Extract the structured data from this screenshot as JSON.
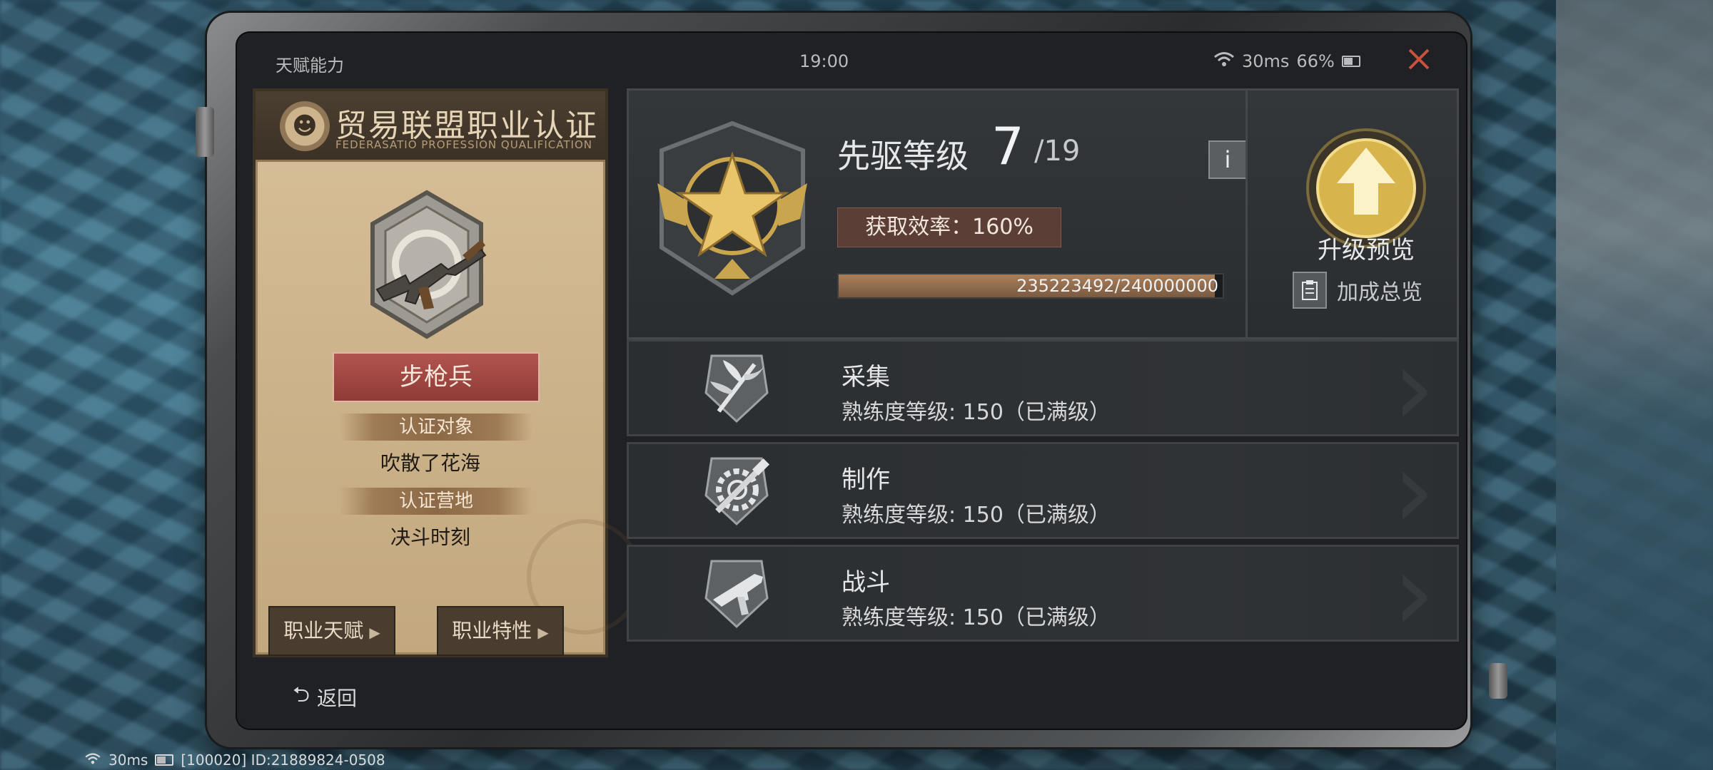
{
  "status_bar": {
    "title": "天赋能力",
    "time": "19:00",
    "ping": "30ms",
    "battery": "66%"
  },
  "certificate": {
    "title": "贸易联盟职业认证",
    "subtitle": "FEDERASATIO PROFESSION QUALIFICATION",
    "class_name": "步枪兵",
    "target_label": "认证对象",
    "target_value": "吹散了花海",
    "camp_label": "认证营地",
    "camp_value": "决斗时刻",
    "btn_talent": "职业天赋",
    "btn_traits": "职业特性"
  },
  "rank": {
    "name": "先驱等级",
    "level": "7",
    "max": "/19",
    "efficiency": "获取效率：160%",
    "progress_text": "235223492/240000000",
    "progress_fraction": 0.98,
    "upgrade_label": "升级预览",
    "bonus_label": "加成总览"
  },
  "skills": [
    {
      "name": "采集",
      "level": "熟练度等级: 150（已满级）",
      "icon": "gather-icon"
    },
    {
      "name": "制作",
      "level": "熟练度等级: 150（已满级）",
      "icon": "craft-icon"
    },
    {
      "name": "战斗",
      "level": "熟练度等级: 150（已满级）",
      "icon": "combat-icon"
    }
  ],
  "back_label": "返回",
  "footer": {
    "ping": "30ms",
    "server_id": "[100020] ID:21889824-0508"
  },
  "colors": {
    "accent_gold": "#e8c46a",
    "class_red": "#a3463f",
    "panel_dark": "#2b2e31",
    "paper": "#cdb48c"
  }
}
